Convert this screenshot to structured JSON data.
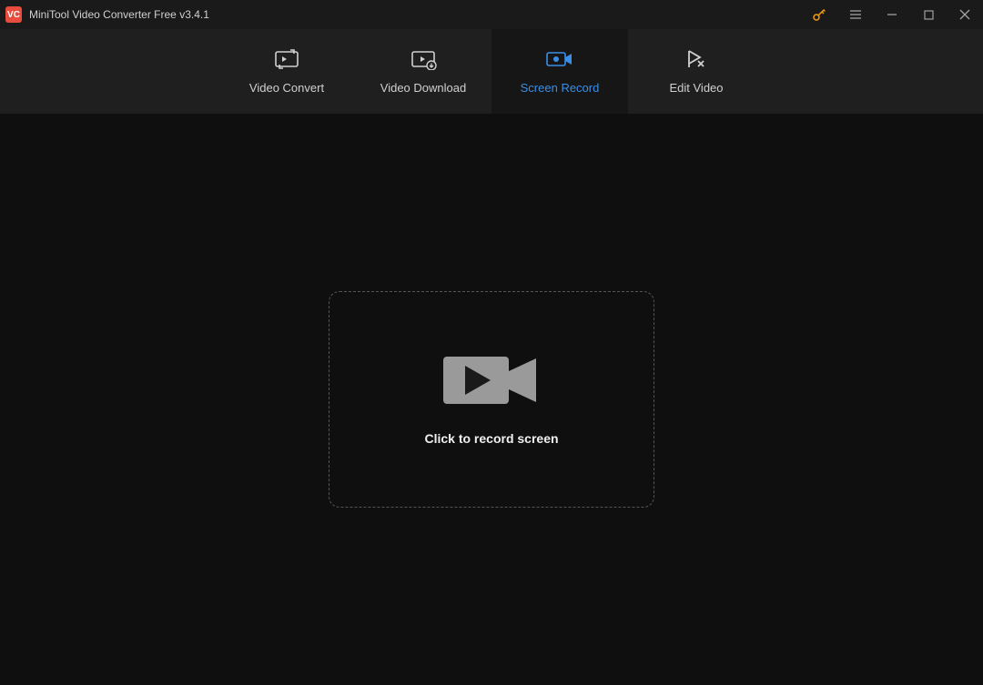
{
  "titlebar": {
    "app_icon_text": "VC",
    "title": "MiniTool Video Converter Free v3.4.1"
  },
  "tabs": [
    {
      "label": "Video Convert"
    },
    {
      "label": "Video Download"
    },
    {
      "label": "Screen Record"
    },
    {
      "label": "Edit Video"
    }
  ],
  "main": {
    "record_label": "Click to record screen"
  }
}
